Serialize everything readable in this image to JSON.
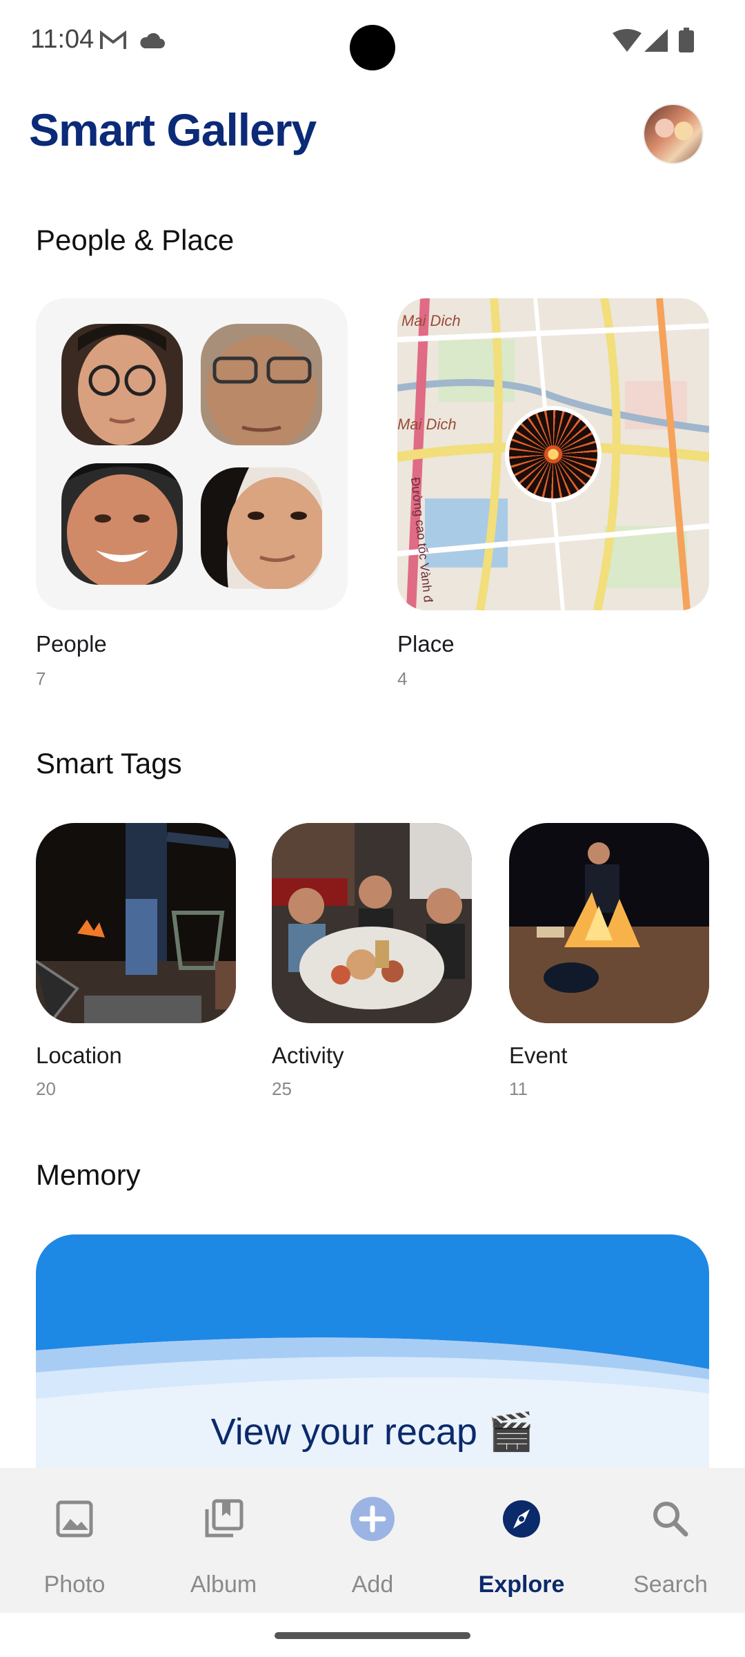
{
  "status_bar": {
    "time": "11:04"
  },
  "header": {
    "title": "Smart Gallery"
  },
  "people_place": {
    "title": "People & Place",
    "people": {
      "label": "People",
      "count": "7"
    },
    "place": {
      "label": "Place",
      "count": "4",
      "map_labels": [
        "Mai Dich",
        "Mai Dich",
        "Đường cao tốc Vành đ"
      ]
    }
  },
  "smart_tags": {
    "title": "Smart Tags",
    "items": [
      {
        "label": "Location",
        "count": "20"
      },
      {
        "label": "Activity",
        "count": "25"
      },
      {
        "label": "Event",
        "count": "11"
      }
    ]
  },
  "memory": {
    "title": "Memory",
    "cta": "View your recap 🎬"
  },
  "nav": {
    "items": [
      {
        "label": "Photo",
        "icon": "photo-icon"
      },
      {
        "label": "Album",
        "icon": "album-icon"
      },
      {
        "label": "Add",
        "icon": "add-icon"
      },
      {
        "label": "Explore",
        "icon": "explore-icon",
        "active": true
      },
      {
        "label": "Search",
        "icon": "search-icon"
      }
    ]
  },
  "colors": {
    "brand": "#0b2a77",
    "memory_blue": "#1e88e5",
    "nav_active": "#0b2a6b"
  }
}
